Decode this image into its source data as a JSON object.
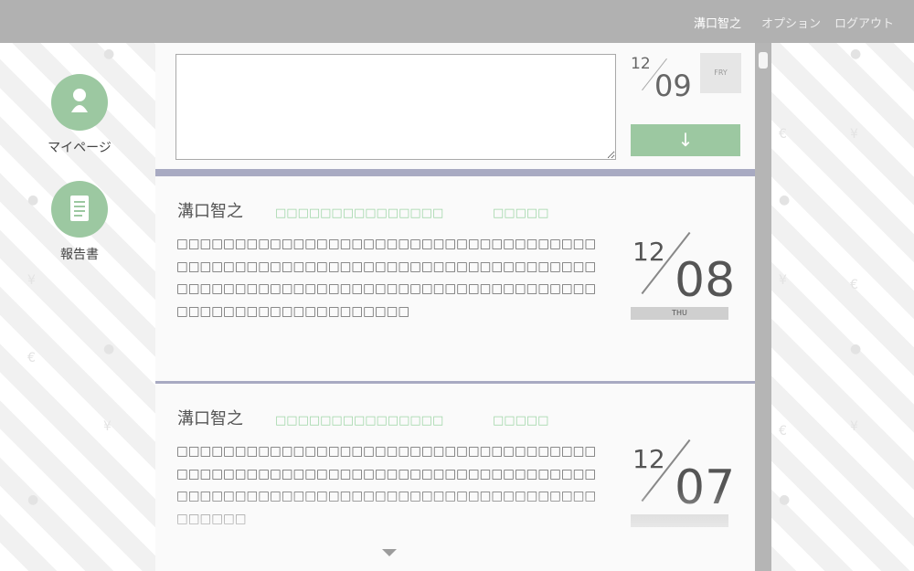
{
  "header": {
    "user_name": "溝口智之",
    "options_label": "オプション",
    "logout_label": "ログアウト"
  },
  "nav": {
    "mypage_label": "マイページ",
    "report_label": "報告書"
  },
  "compose": {
    "month": "12",
    "day": "09",
    "weekday": "FRY",
    "submit_glyph": "↓"
  },
  "posts": [
    {
      "author": "溝口智之",
      "tag": "□□□□□□□□□□□□□□□",
      "tag2": "□□□□□",
      "body": "□□□□□□□□□□□□□□□□□□□□□□□□□□□□□□□□□□□□□□□□□□□□□□□□□□□□□□□□□□□□□□□□□□□□□□□□□□□□□□□□□□□□□□□□□□□□□□□□□□□□□□□□□□□□□□□□□□□□□□□□□□□□□□□□",
      "month": "12",
      "day": "08",
      "weekday": "THU"
    },
    {
      "author": "溝口智之",
      "tag": "□□□□□□□□□□□□□□□",
      "tag2": "□□□□□",
      "body": "□□□□□□□□□□□□□□□□□□□□□□□□□□□□□□□□□□□□□□□□□□□□□□□□□□□□□□□□□□□□□□□□□□□□□□□□□□□□□□□□□□□□□□□□□□□□□□□□□□□□□□□□□□□□□□□□□□",
      "month": "12",
      "day": "07",
      "weekday": ""
    }
  ],
  "colors": {
    "accent_green": "#9cc8a1",
    "topbar": "#b1b1b1",
    "divider": "#a8aac2"
  },
  "icons": [
    "user-icon",
    "document-icon",
    "down-arrow-icon",
    "chevron-down-icon"
  ]
}
